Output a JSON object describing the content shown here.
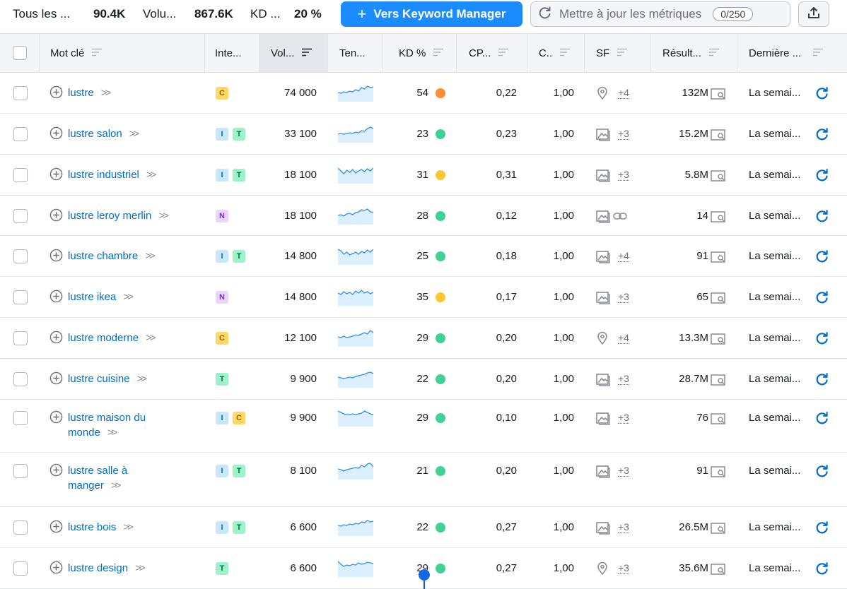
{
  "stats": {
    "all_label": "Tous les ...",
    "all_value": "90.4K",
    "volume_label": "Volu...",
    "volume_value": "867.6K",
    "kd_label": "KD ...",
    "kd_value": "20 %"
  },
  "toolbar": {
    "keyword_manager_label": "Vers Keyword Manager",
    "update_metrics_label": "Mettre à jour les métriques",
    "update_counter": "0/250"
  },
  "columns": {
    "keyword": "Mot clé",
    "intent": "Inte...",
    "volume": "Vol...",
    "trend": "Ten...",
    "kd": "KD %",
    "cpc": "CP...",
    "com": "C..",
    "sf": "SF",
    "results": "Résult...",
    "updated": "Dernière ..."
  },
  "colors": {
    "accent": "#1a8cff",
    "link": "#006dca",
    "kd_orange": "#ff8c32",
    "kd_yellow": "#ffc533",
    "kd_green": "#3ed295"
  },
  "rows": [
    {
      "keyword": "lustre",
      "intents": [
        "C"
      ],
      "volume": "74 000",
      "trend": [
        0.55,
        0.6,
        0.5,
        0.55,
        0.45,
        0.5,
        0.35,
        0.45,
        0.2,
        0.3,
        0.1,
        0.2,
        0.15
      ],
      "kd": "54",
      "kd_color": "#ff8c32",
      "cpc": "0,22",
      "com": "1,00",
      "sf_icon": "location-pin-icon",
      "sf_count": "+4",
      "results": "132M",
      "updated": "La semai..."
    },
    {
      "keyword": "lustre salon",
      "intents": [
        "I",
        "T"
      ],
      "volume": "33 100",
      "trend": [
        0.6,
        0.55,
        0.6,
        0.55,
        0.5,
        0.55,
        0.45,
        0.5,
        0.35,
        0.4,
        0.2,
        0.1,
        0.2
      ],
      "kd": "23",
      "kd_color": "#3ed295",
      "cpc": "0,23",
      "com": "1,00",
      "sf_icon": "image-icon",
      "sf_count": "+3",
      "results": "15.2M",
      "updated": "La semai..."
    },
    {
      "keyword": "lustre industriel",
      "intents": [
        "I",
        "T"
      ],
      "volume": "18 100",
      "trend": [
        0.1,
        0.3,
        0.5,
        0.25,
        0.4,
        0.2,
        0.45,
        0.3,
        0.2,
        0.35,
        0.15,
        0.3,
        0.1
      ],
      "kd": "31",
      "kd_color": "#ffc533",
      "cpc": "0,31",
      "com": "1,00",
      "sf_icon": "image-icon",
      "sf_count": "+3",
      "results": "5.8M",
      "updated": "La semai..."
    },
    {
      "keyword": "lustre leroy merlin",
      "intents": [
        "N"
      ],
      "volume": "18 100",
      "trend": [
        0.55,
        0.5,
        0.6,
        0.45,
        0.4,
        0.5,
        0.35,
        0.3,
        0.15,
        0.2,
        0.1,
        0.3,
        0.35
      ],
      "kd": "28",
      "kd_color": "#3ed295",
      "cpc": "0,12",
      "com": "1,00",
      "sf_icon": "image-icon",
      "sf_icon2": "link-icon",
      "sf_count": "",
      "results": "14",
      "updated": "La semai..."
    },
    {
      "keyword": "lustre chambre",
      "intents": [
        "I",
        "T"
      ],
      "volume": "14 800",
      "trend": [
        0.1,
        0.2,
        0.45,
        0.3,
        0.5,
        0.4,
        0.3,
        0.45,
        0.25,
        0.35,
        0.15,
        0.3,
        0.1
      ],
      "kd": "25",
      "kd_color": "#3ed295",
      "cpc": "0,18",
      "com": "1,00",
      "sf_icon": "image-icon",
      "sf_count": "+4",
      "results": "91",
      "updated": "La semai..."
    },
    {
      "keyword": "lustre ikea",
      "intents": [
        "N"
      ],
      "volume": "14 800",
      "trend": [
        0.3,
        0.4,
        0.2,
        0.35,
        0.25,
        0.4,
        0.15,
        0.3,
        0.1,
        0.3,
        0.2,
        0.35,
        0.25
      ],
      "kd": "35",
      "kd_color": "#ffc533",
      "cpc": "0,17",
      "com": "1,00",
      "sf_icon": "image-icon",
      "sf_count": "+3",
      "results": "65",
      "updated": "La semai..."
    },
    {
      "keyword": "lustre moderne",
      "intents": [
        "C"
      ],
      "volume": "12 100",
      "trend": [
        0.5,
        0.55,
        0.45,
        0.55,
        0.5,
        0.45,
        0.35,
        0.4,
        0.3,
        0.2,
        0.3,
        0.05,
        0.2
      ],
      "kd": "29",
      "kd_color": "#3ed295",
      "cpc": "0,20",
      "com": "1,00",
      "sf_icon": "location-pin-icon",
      "sf_count": "+4",
      "results": "13.3M",
      "updated": "La semai..."
    },
    {
      "keyword": "lustre cuisine",
      "intents": [
        "T"
      ],
      "volume": "9 900",
      "trend": [
        0.45,
        0.5,
        0.55,
        0.5,
        0.45,
        0.5,
        0.4,
        0.35,
        0.3,
        0.25,
        0.15,
        0.1,
        0.2
      ],
      "kd": "22",
      "kd_color": "#3ed295",
      "cpc": "0,20",
      "com": "1,00",
      "sf_icon": "image-icon",
      "sf_count": "+3",
      "results": "28.7M",
      "updated": "La semai..."
    },
    {
      "keyword": "lustre maison du monde",
      "intents": [
        "I",
        "C"
      ],
      "volume": "9 900",
      "trend": [
        0.1,
        0.2,
        0.3,
        0.35,
        0.35,
        0.3,
        0.35,
        0.3,
        0.25,
        0.1,
        0.2,
        0.3,
        0.35
      ],
      "kd": "29",
      "kd_color": "#3ed295",
      "cpc": "0,10",
      "com": "1,00",
      "sf_icon": "image-icon",
      "sf_count": "+3",
      "results": "76",
      "updated": "La semai..."
    },
    {
      "keyword": "lustre salle à manger",
      "intents": [
        "I",
        "T"
      ],
      "volume": "8 100",
      "trend": [
        0.45,
        0.5,
        0.6,
        0.5,
        0.45,
        0.4,
        0.35,
        0.4,
        0.2,
        0.3,
        0.1,
        0.05,
        0.3
      ],
      "kd": "21",
      "kd_color": "#3ed295",
      "cpc": "0,20",
      "com": "1,00",
      "sf_icon": "image-icon",
      "sf_count": "+3",
      "results": "91",
      "updated": "La semai..."
    },
    {
      "keyword": "lustre bois",
      "intents": [
        "I",
        "T"
      ],
      "volume": "6 600",
      "trend": [
        0.45,
        0.5,
        0.4,
        0.45,
        0.35,
        0.4,
        0.3,
        0.35,
        0.2,
        0.25,
        0.1,
        0.2,
        0.15
      ],
      "kd": "22",
      "kd_color": "#3ed295",
      "cpc": "0,27",
      "com": "1,00",
      "sf_icon": "image-icon",
      "sf_count": "+3",
      "results": "26.5M",
      "updated": "La semai..."
    },
    {
      "keyword": "lustre design",
      "intents": [
        "T"
      ],
      "volume": "6 600",
      "trend": [
        0.1,
        0.3,
        0.45,
        0.35,
        0.4,
        0.3,
        0.35,
        0.2,
        0.3,
        0.25,
        0.15,
        0.2,
        0.25
      ],
      "kd": "29",
      "kd_color": "#3ed295",
      "cpc": "0,27",
      "com": "1,00",
      "sf_icon": "location-pin-icon",
      "sf_count": "+3",
      "results": "35.6M",
      "updated": "La semai..."
    }
  ]
}
